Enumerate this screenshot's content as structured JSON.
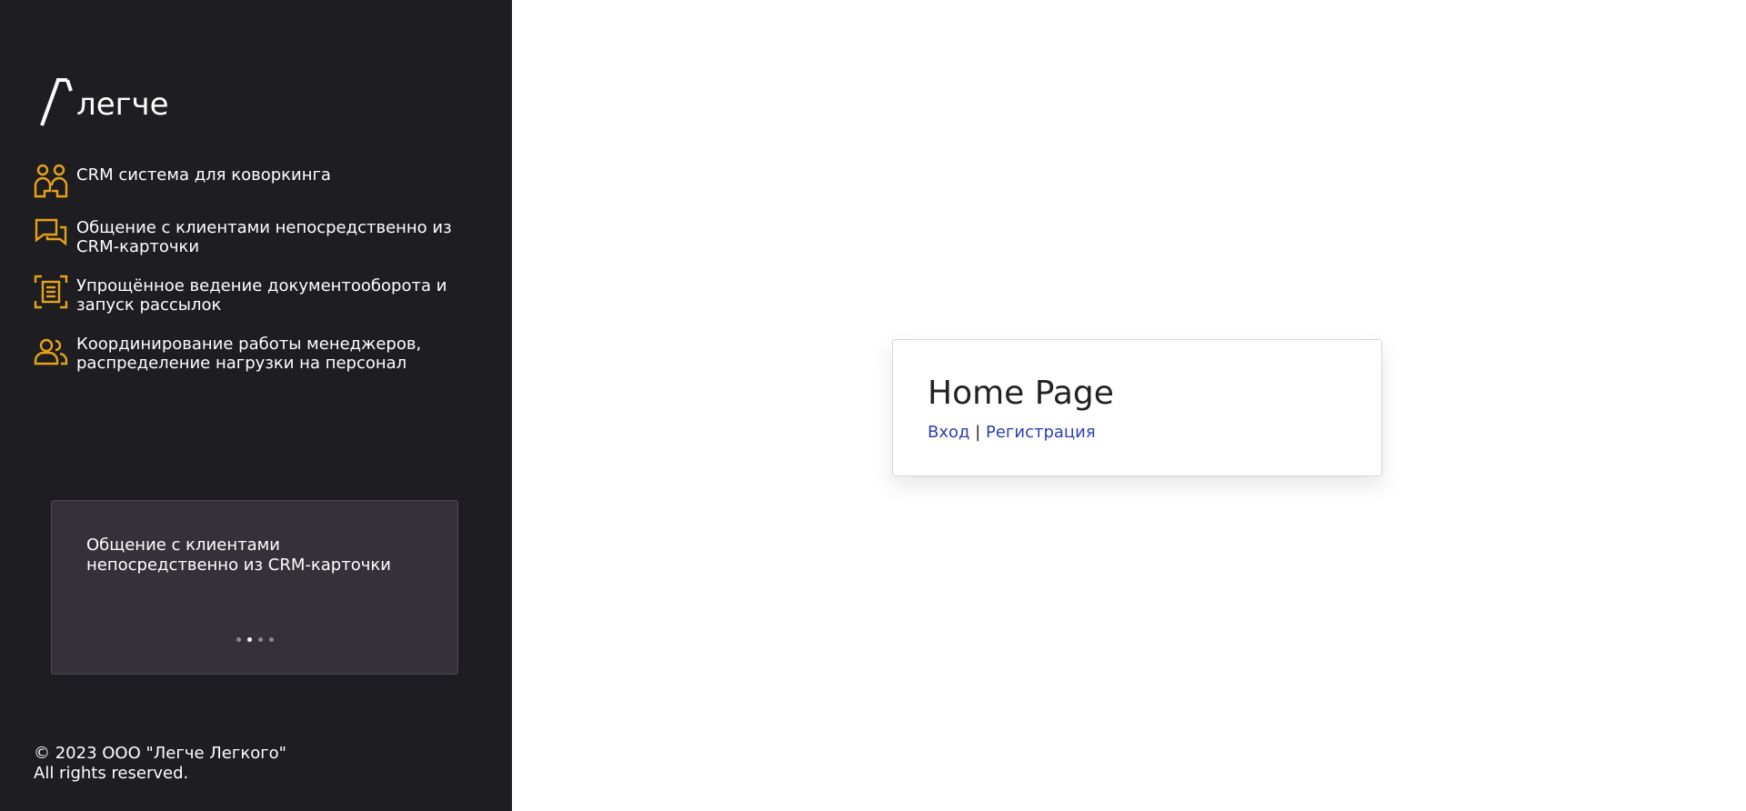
{
  "brand": {
    "name": "легче"
  },
  "features": [
    {
      "icon": "users-icon",
      "label": "CRM система для коворкинга"
    },
    {
      "icon": "chat-icon",
      "label": "Общение с клиентами непосредственно из CRM-карточки"
    },
    {
      "icon": "document-scan-icon",
      "label": "Упрощённое ведение документооборота и запуск рассылок"
    },
    {
      "icon": "team-icon",
      "label": "Координирование работы менеджеров, распределение нагрузки на персонал"
    }
  ],
  "carousel": {
    "text": "Общение с клиентами непосредственно из CRM-карточки",
    "slide_count": 4,
    "active_index": 1
  },
  "footer": {
    "line1": "© 2023 ООО \"Легче Легкого\"",
    "line2": "All rights reserved."
  },
  "card": {
    "title": "Home Page",
    "login_label": "Вход",
    "separator": " | ",
    "register_label": "Регистрация"
  },
  "colors": {
    "sidebar_bg": "#1e1d21",
    "accent": "#e6a317",
    "link": "#2b3fb3"
  }
}
